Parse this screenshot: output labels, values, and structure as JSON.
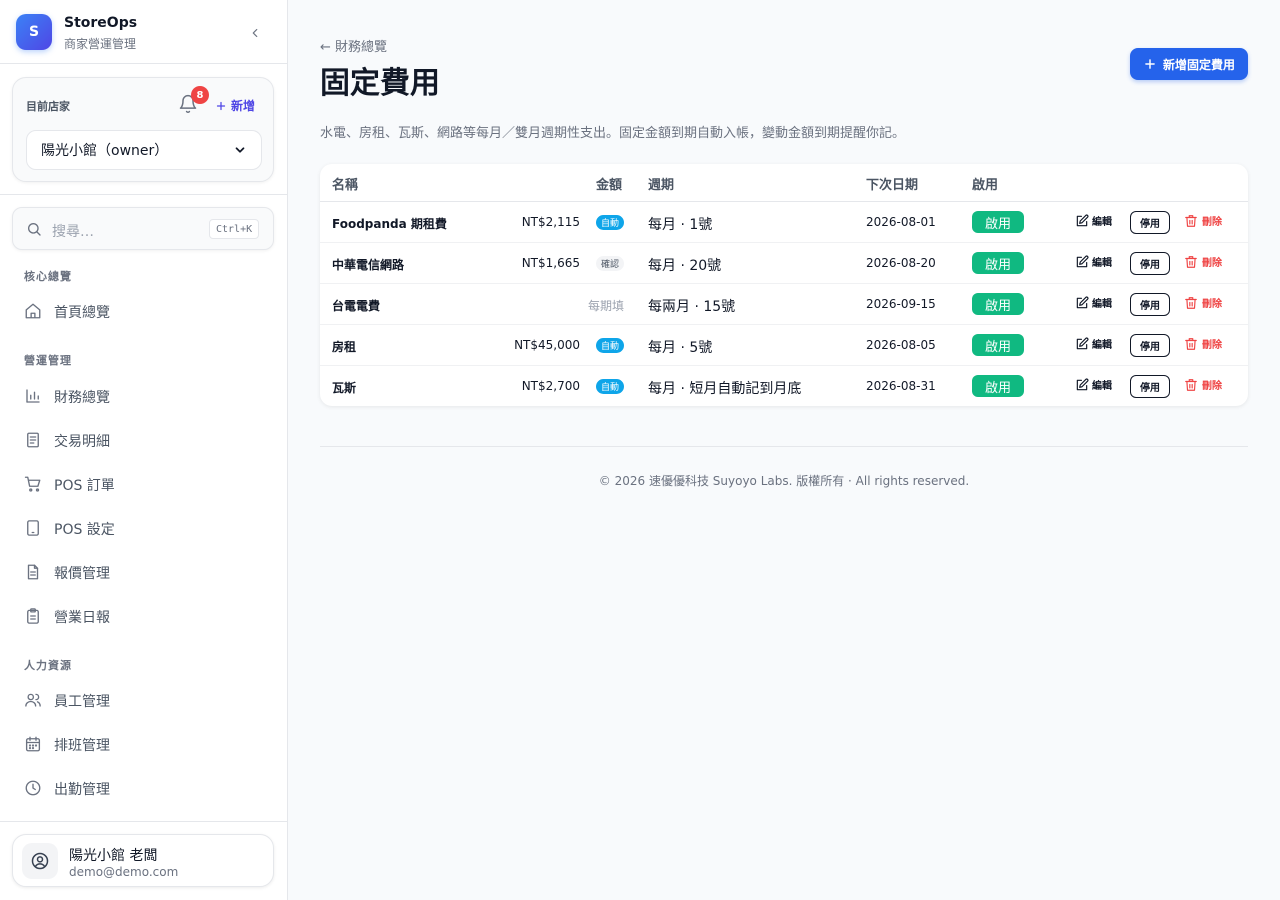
{
  "app": {
    "name": "StoreOps",
    "subtitle": "商家營運管理",
    "logo_letter": "S"
  },
  "store": {
    "label": "目前店家",
    "notification_count": "8",
    "add_label": "新增",
    "selected": "陽光小館（owner）"
  },
  "search": {
    "placeholder": "搜尋…",
    "shortcut": "Ctrl+K"
  },
  "nav": {
    "section_core": "核心總覽",
    "section_ops": "營運管理",
    "section_hr": "人力資源",
    "items": {
      "home": "首頁總覽",
      "finance": "財務總覽",
      "transactions": "交易明細",
      "pos_orders": "POS 訂單",
      "pos_settings": "POS 設定",
      "quotes": "報價管理",
      "daily_report": "營業日報",
      "staff": "員工管理",
      "schedule": "排班管理",
      "attendance": "出勤管理"
    }
  },
  "user": {
    "name": "陽光小館 老闆",
    "email": "demo@demo.com"
  },
  "page": {
    "back_label": "← 財務總覽",
    "title": "固定費用",
    "new_button": "新增固定費用",
    "description": "水電、房租、瓦斯、網路等每月／雙月週期性支出。固定金額到期自動入帳，變動金額到期提醒你記。"
  },
  "table": {
    "headers": {
      "name": "名稱",
      "amount": "金額",
      "cycle": "週期",
      "next_date": "下次日期",
      "enabled": "啟用"
    },
    "actions": {
      "edit": "編輯",
      "disable": "停用",
      "delete": "刪除"
    },
    "rows": [
      {
        "name": "Foodpanda 期租費",
        "amount": "NT$2,115",
        "badge": "自動",
        "badge_type": "auto",
        "cycle": "每月 · 1號",
        "next_date": "2026-08-01",
        "enabled": "啟用"
      },
      {
        "name": "中華電信網路",
        "amount": "NT$1,665",
        "badge": "確認",
        "badge_type": "confirm",
        "cycle": "每月 · 20號",
        "next_date": "2026-08-20",
        "enabled": "啟用"
      },
      {
        "name": "台電電費",
        "amount": "每期填",
        "badge": "",
        "badge_type": "none",
        "cycle": "每兩月 · 15號",
        "next_date": "2026-09-15",
        "enabled": "啟用"
      },
      {
        "name": "房租",
        "amount": "NT$45,000",
        "badge": "自動",
        "badge_type": "auto",
        "cycle": "每月 · 5號",
        "next_date": "2026-08-05",
        "enabled": "啟用"
      },
      {
        "name": "瓦斯",
        "amount": "NT$2,700",
        "badge": "自動",
        "badge_type": "auto",
        "cycle": "每月 · 短月自動記到月底",
        "next_date": "2026-08-31",
        "enabled": "啟用"
      }
    ]
  },
  "footer": {
    "text": "© 2026 速優優科技 Suyoyo Labs. 版權所有 · All rights reserved."
  },
  "colors": {
    "primary": "#2563eb",
    "success": "#10b981",
    "danger": "#ef4444",
    "info": "#0ea5e9",
    "badge": "#ef4444"
  }
}
